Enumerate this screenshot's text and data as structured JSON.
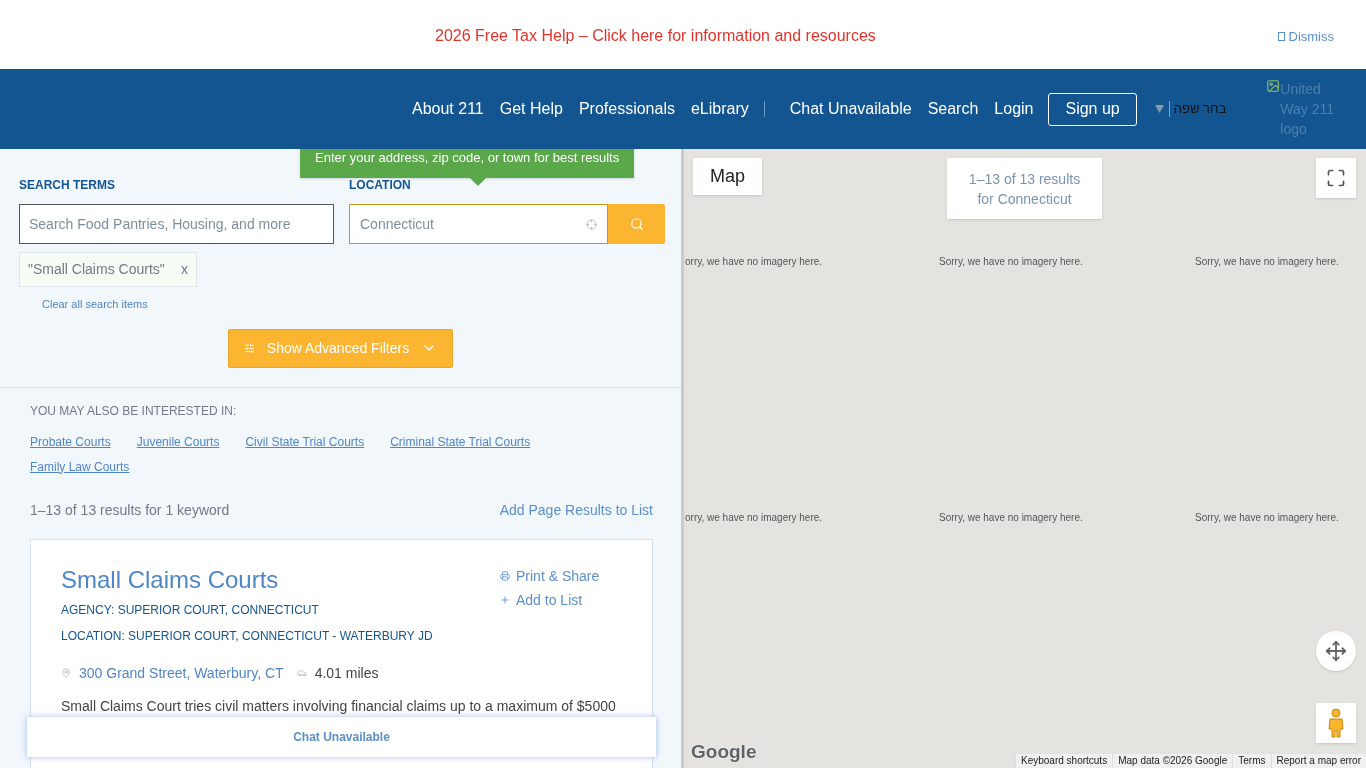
{
  "banner": {
    "text": "2026 Free Tax Help – Click here for information and resources",
    "dismiss": "Dismiss"
  },
  "nav": {
    "links": [
      "About 211",
      "Get Help",
      "Professionals",
      "eLibrary"
    ],
    "links_right": [
      "Chat Unavailable",
      "Search",
      "Login"
    ],
    "signup": "Sign up",
    "language": "בחר שפה",
    "logo_alt": "United Way 211 logo"
  },
  "search": {
    "terms_label": "SEARCH TERMS",
    "terms_placeholder": "Search Food Pantries, Housing, and more",
    "location_label": "LOCATION",
    "location_value": "Connecticut",
    "tooltip": "Enter your address, zip code, or town for best results",
    "chips": [
      {
        "label": "\"Small Claims Courts\"",
        "remove": "x"
      }
    ],
    "clear": "Clear all search items",
    "advanced": "Show Advanced Filters"
  },
  "related": {
    "heading": "YOU MAY ALSO BE INTERESTED IN:",
    "links": [
      "Probate Courts",
      "Juvenile Courts",
      "Civil State Trial Courts",
      "Criminal State Trial Courts",
      "Family Law Courts"
    ]
  },
  "results": {
    "summary": "1–13 of 13 results for 1 keyword",
    "add_all": "Add Page Results to List",
    "items": [
      {
        "title": "Small Claims Courts",
        "agency": "AGENCY: SUPERIOR COURT, CONNECTICUT",
        "location": "LOCATION: SUPERIOR COURT, CONNECTICUT - WATERBURY JD",
        "print": "Print & Share",
        "add": "Add to List",
        "address": "300 Grand Street, Waterbury, CT",
        "distance": "4.01 miles",
        "description": "Small Claims Court tries civil matters involving financial claims up to a maximum of $5000"
      }
    ]
  },
  "chat_bar": "Chat Unavailable",
  "map": {
    "type_button": "Map",
    "summary": [
      "1–13 of 13 results",
      "for Connecticut"
    ],
    "tiles": [
      "orry, we have no imagery here.",
      "Sorry, we have no imagery here.",
      "Sorry, we have no imagery here.",
      "orry, we have no imagery here.",
      "Sorry, we have no imagery here.",
      "Sorry, we have no imagery here."
    ],
    "google": "Google",
    "footer": [
      "Keyboard shortcuts",
      "Map data ©2026 Google",
      "Terms",
      "Report a map error"
    ]
  }
}
